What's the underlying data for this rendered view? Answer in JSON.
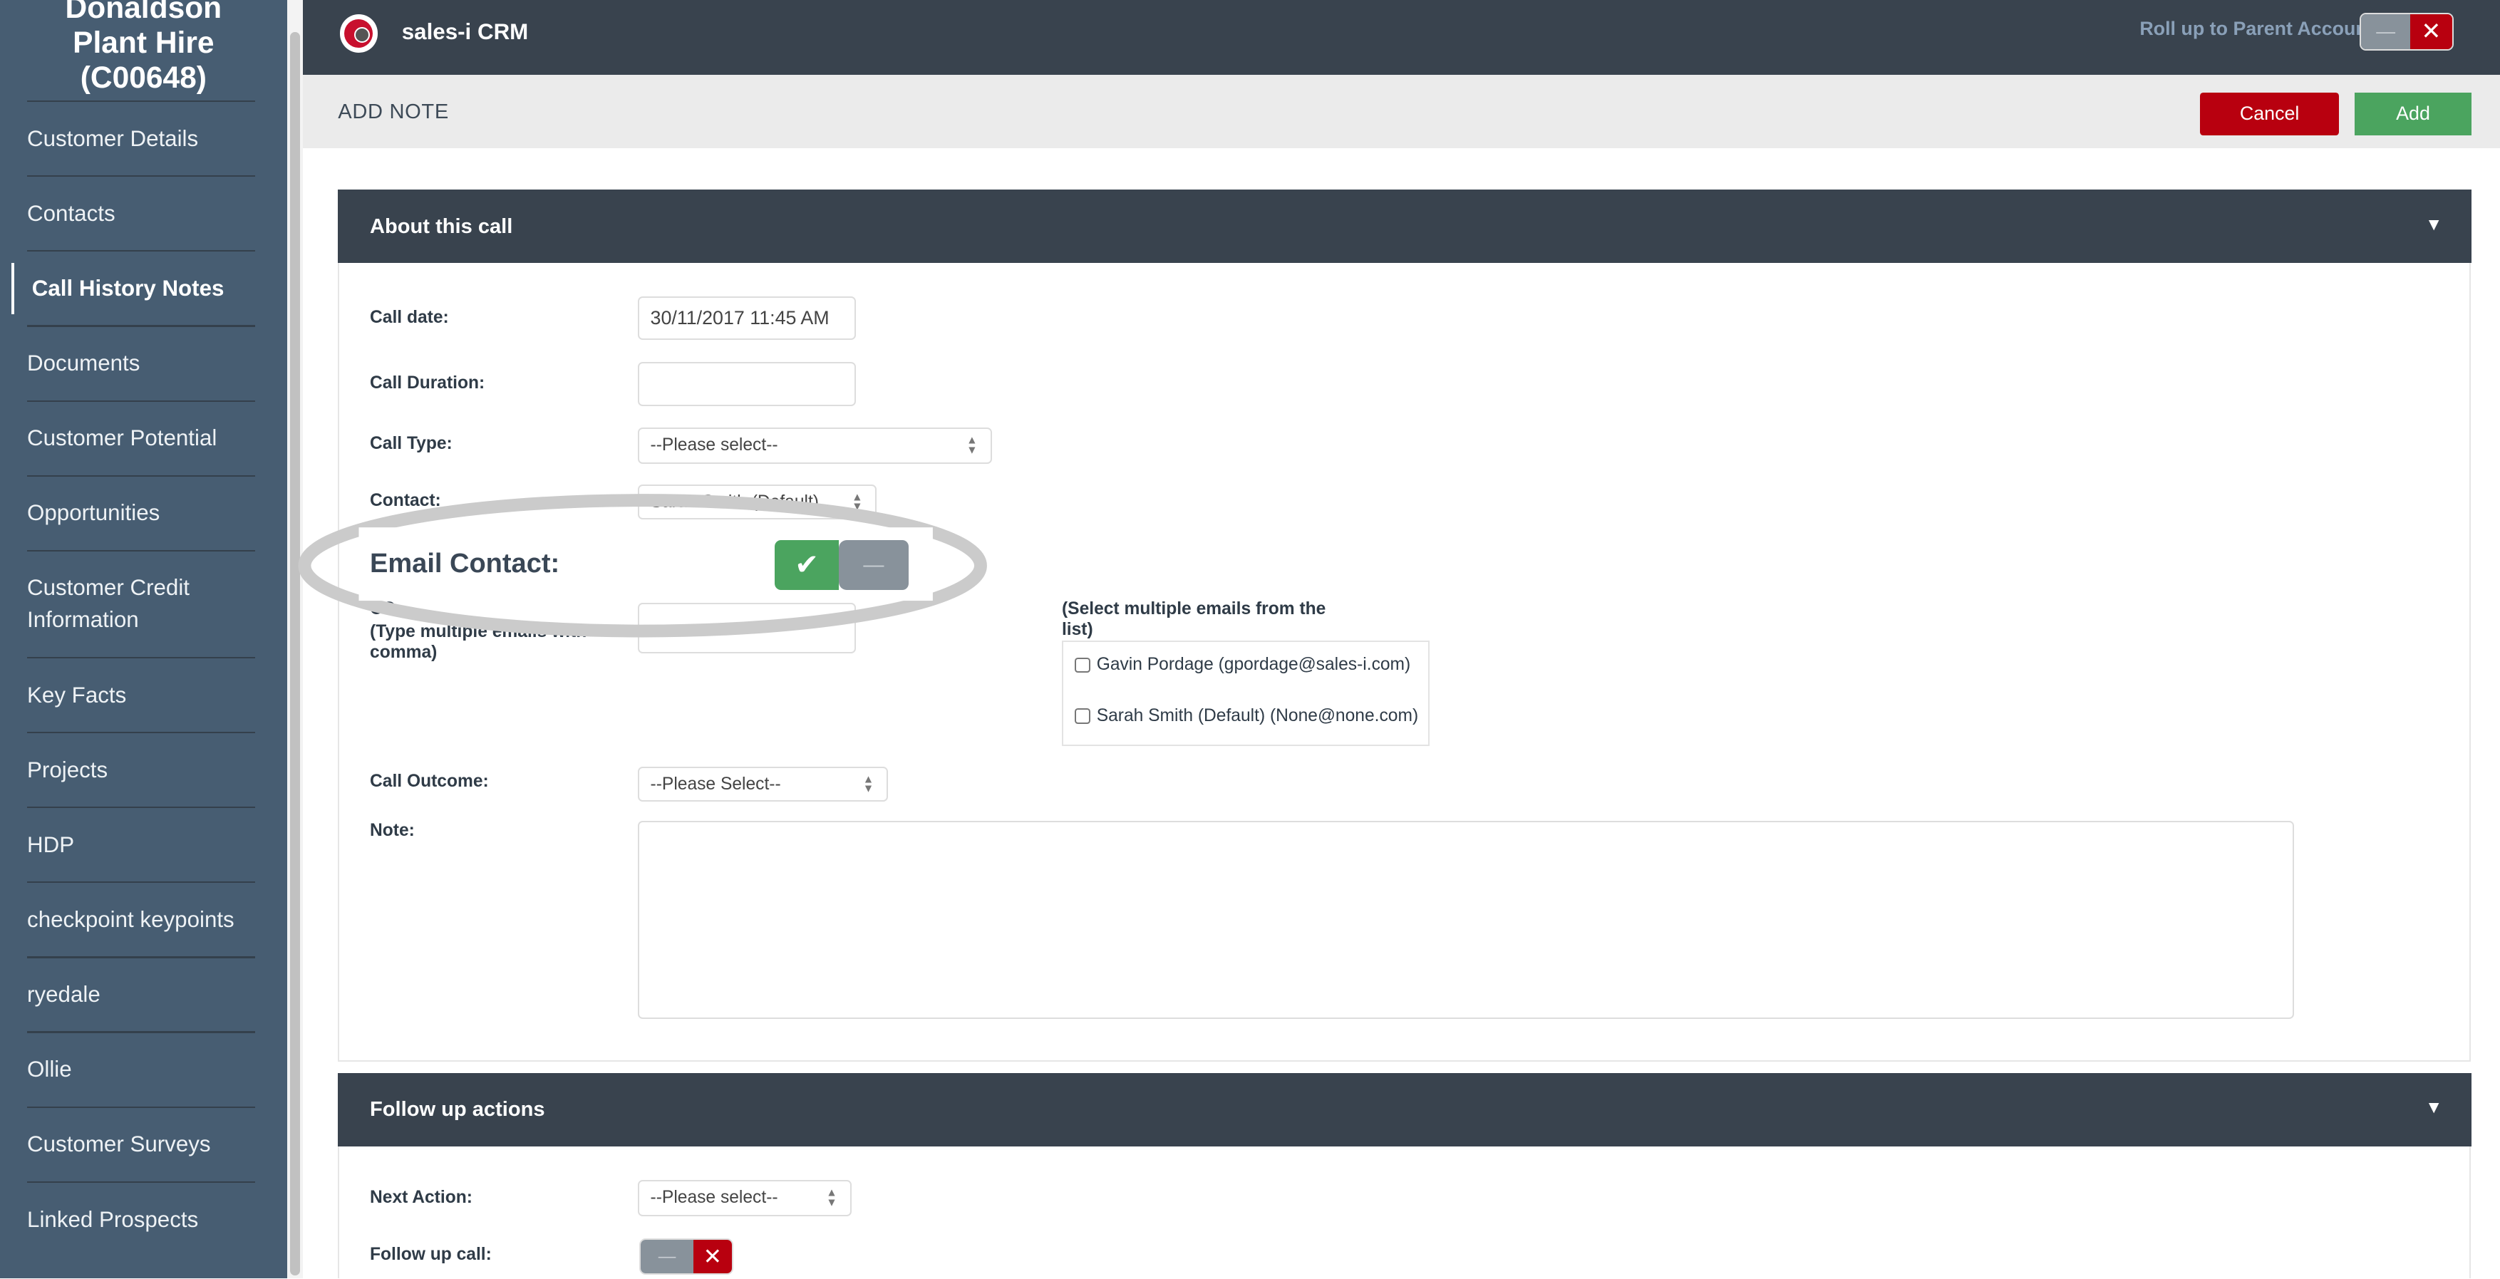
{
  "sidebar": {
    "account_title_line1": "Donaldson",
    "account_title_line2": "Plant Hire",
    "account_title_line3": "(C00648)",
    "items": [
      {
        "label": "Customer Details"
      },
      {
        "label": "Contacts"
      },
      {
        "label": "Call History Notes",
        "active": true
      },
      {
        "label": "Documents"
      },
      {
        "label": "Customer Potential"
      },
      {
        "label": "Opportunities"
      },
      {
        "label": "Customer Credit Information"
      },
      {
        "label": "Key Facts"
      },
      {
        "label": "Projects"
      },
      {
        "label": "HDP"
      },
      {
        "label": "checkpoint keypoints"
      },
      {
        "label": "ryedale"
      },
      {
        "label": "Ollie"
      },
      {
        "label": "Customer Surveys"
      },
      {
        "label": "Linked Prospects"
      }
    ]
  },
  "header": {
    "app_name": "sales-i CRM",
    "rollup_label": "Roll up to Parent Account:",
    "rollup_state": "off"
  },
  "subheader": {
    "title": "ADD NOTE",
    "cancel_label": "Cancel",
    "add_label": "Add"
  },
  "colors": {
    "sidebar": "#475d72",
    "topbar": "#39434e",
    "cancel": "#b8000f",
    "add": "#4ba45f"
  },
  "about": {
    "title": "About this call",
    "call_date_label": "Call date:",
    "call_date_value": "30/11/2017 11:45 AM",
    "call_duration_label": "Call Duration:",
    "call_duration_value": "",
    "call_type_label": "Call Type:",
    "call_type_value": "--Please select--",
    "contact_label": "Contact:",
    "contact_value": "Sarah Smith (Default)",
    "email_contact_label": "Email Contact:",
    "email_contact_state": "on",
    "cc_label": "CC",
    "cc_hint_line1": "(Type multiple emails with",
    "cc_hint_line2": "comma)",
    "cc_value": "",
    "select_hint_line1": "(Select multiple emails from the",
    "select_hint_line2": "list)",
    "email_options": [
      {
        "label": "Gavin Pordage (gpordage@sales-i.com)",
        "checked": false
      },
      {
        "label": "Sarah Smith (Default) (None@none.com)",
        "checked": false
      }
    ],
    "call_outcome_label": "Call Outcome:",
    "call_outcome_value": "--Please Select--",
    "note_label": "Note:",
    "note_value": ""
  },
  "followup": {
    "title": "Follow up actions",
    "next_action_label": "Next Action:",
    "next_action_value": "--Please select--",
    "follow_up_call_label": "Follow up call:",
    "follow_up_call_state": "off"
  }
}
